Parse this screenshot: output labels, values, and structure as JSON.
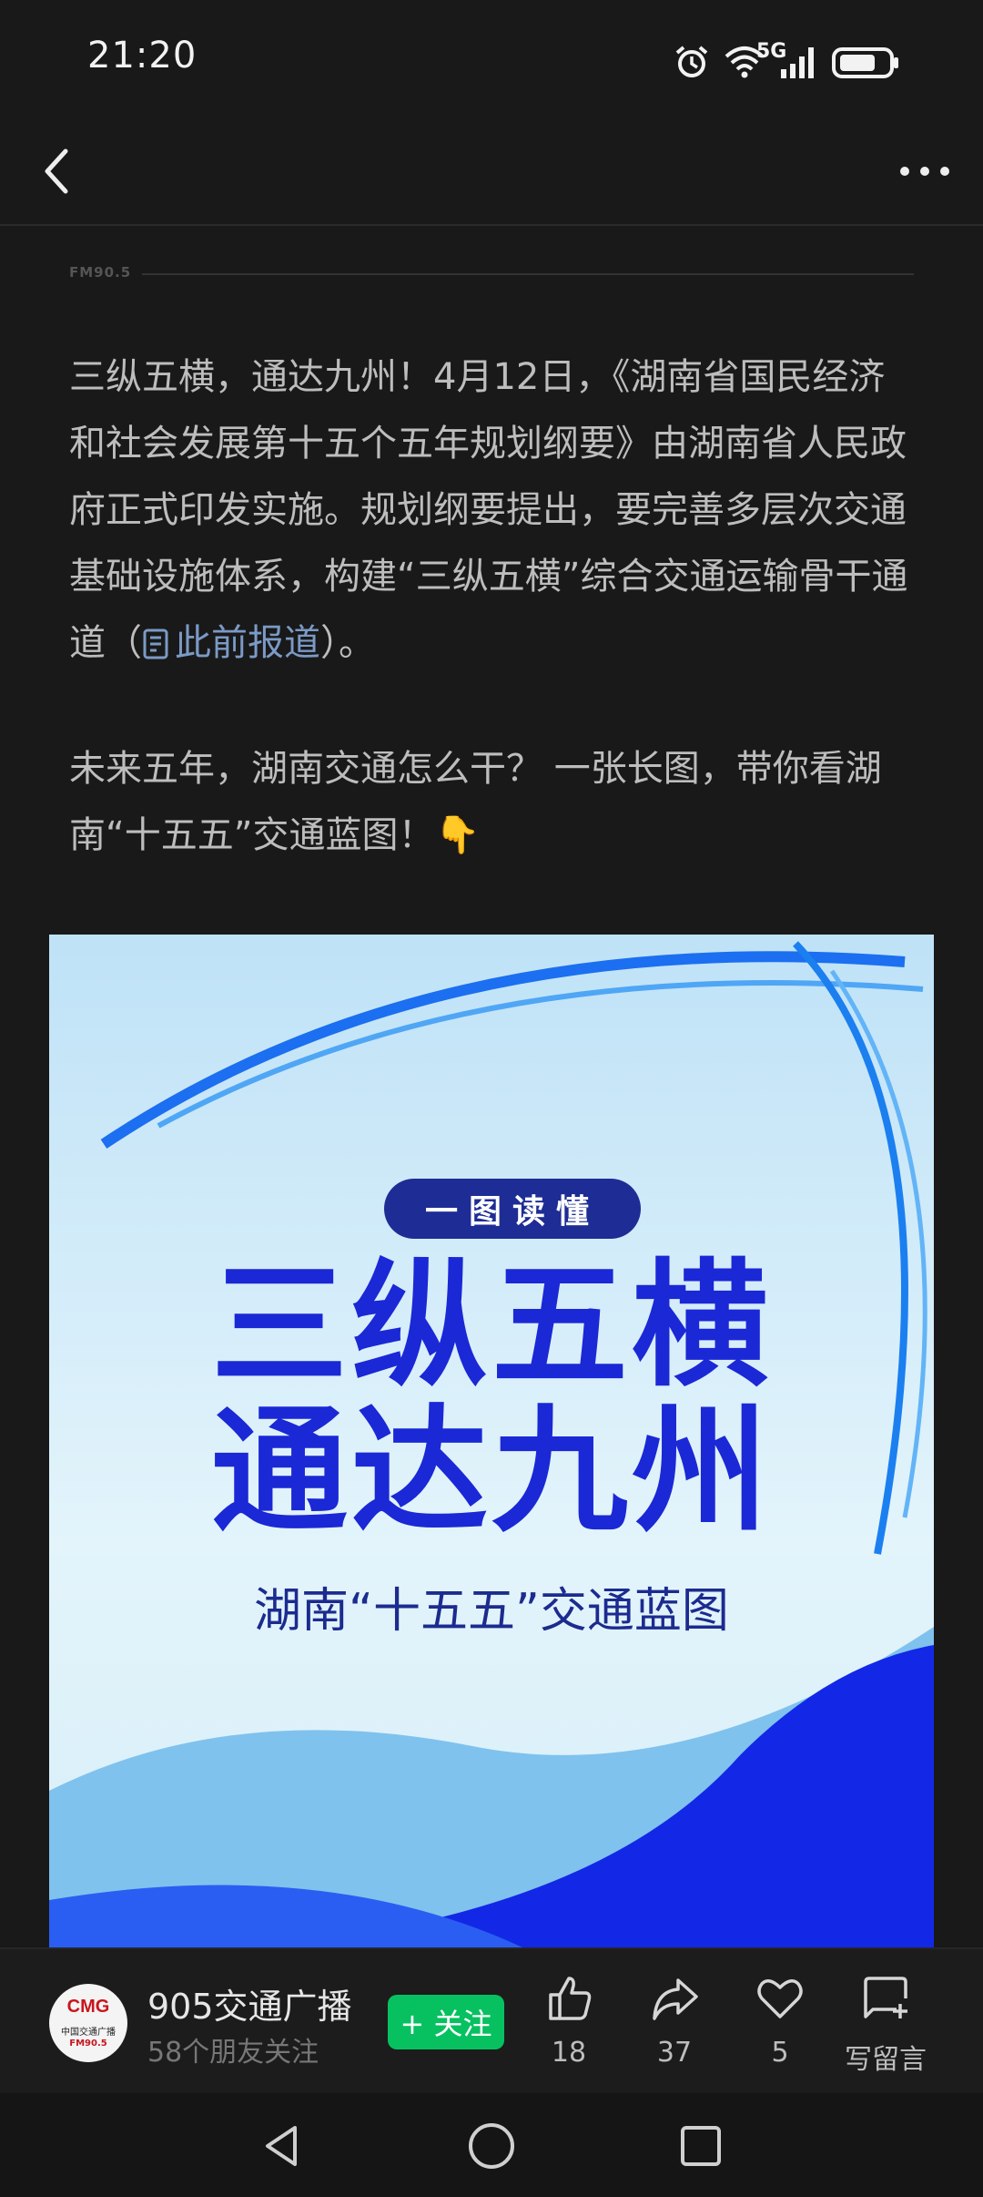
{
  "status": {
    "time": "21:20",
    "network": "5G"
  },
  "article": {
    "source_tag": "FM90.5",
    "para1_part1": "三纵五横，通达九州！4月12日，《湖南省国民经济和社会发展第十五个五年规划纲要》由湖南省人民政府正式印发实施。规划纲要提出，要完善多层次交通基础设施体系，构建“三纵五横”综合交通运输骨干通道（",
    "link_text": "此前报道",
    "para1_part2": "）。",
    "para2": "未来五年，湖南交通怎么干？ 一张长图，带你看湖南“十五五”交通蓝图！👇"
  },
  "poster": {
    "pill": "一图读懂",
    "headline1": "三纵五横",
    "headline2": "通达九州",
    "subtitle": "湖南“十五五”交通蓝图"
  },
  "account": {
    "avatar_logo": "CMG",
    "avatar_sub": "中国交通广播",
    "avatar_fm": "FM90.5",
    "name": "905交通广播",
    "followers": "58个朋友关注",
    "follow_label": "+ 关注"
  },
  "actions": {
    "like_count": "18",
    "share_count": "37",
    "favorite_count": "5",
    "comment_label": "写留言"
  },
  "icons": [
    "alarm-icon",
    "wifi-icon",
    "signal-icon",
    "battery-icon",
    "back-icon",
    "more-icon",
    "thumb-up-icon",
    "share-icon",
    "heart-icon",
    "comment-icon",
    "nav-back-icon",
    "nav-home-icon",
    "nav-recents-icon"
  ]
}
